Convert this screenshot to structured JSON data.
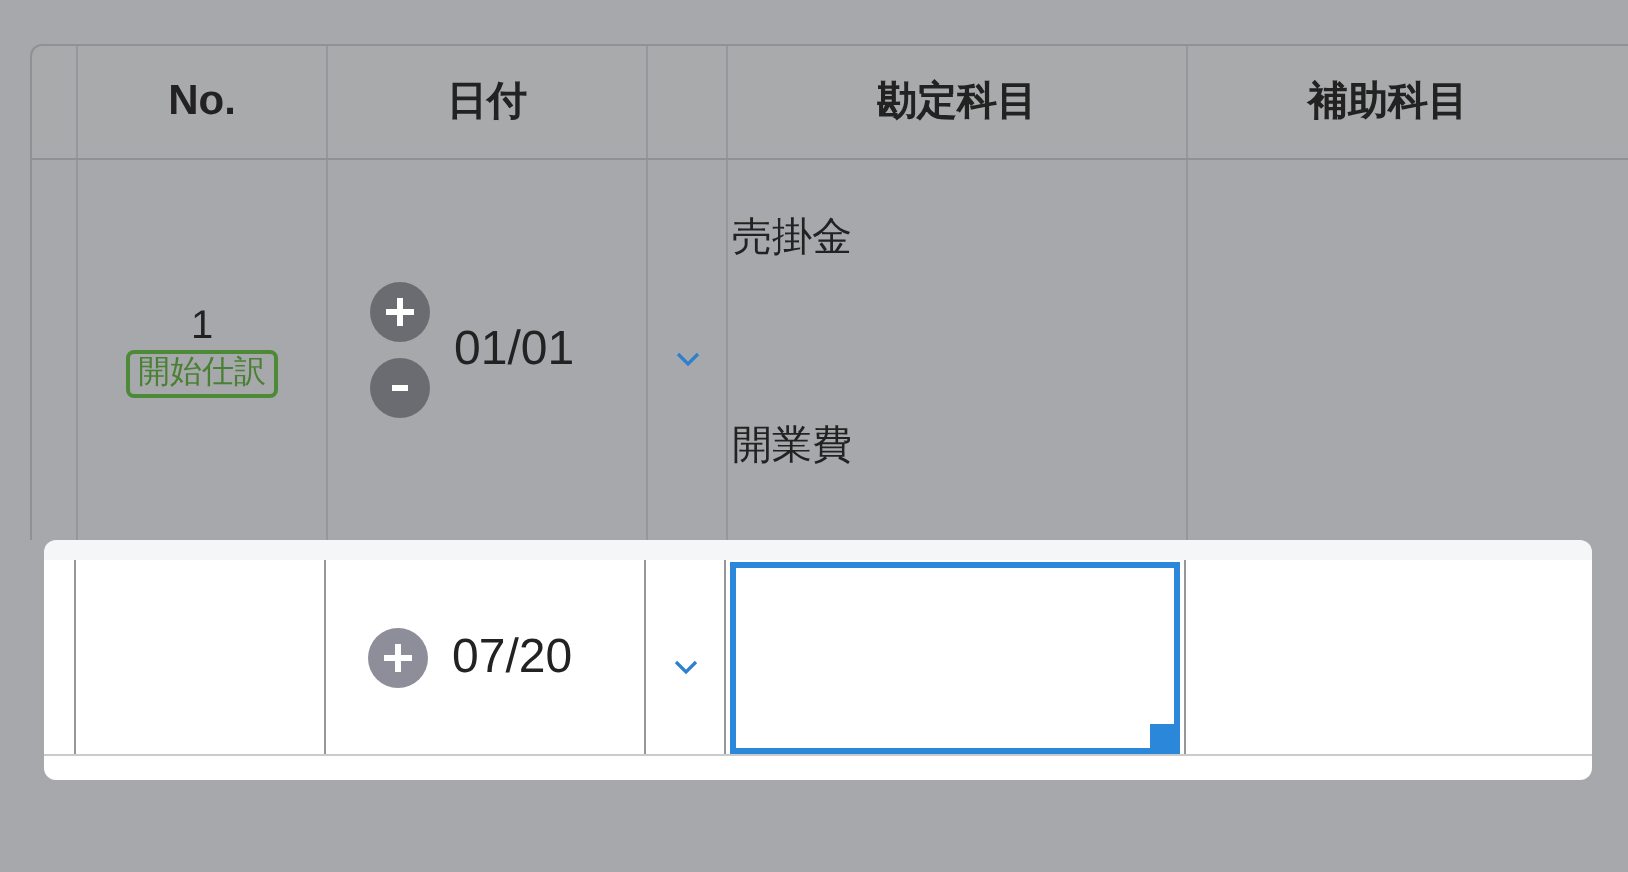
{
  "table": {
    "columns": {
      "no": "No.",
      "date": "日付",
      "account": "勘定科目",
      "sub_account": "補助科目"
    },
    "rows": [
      {
        "highlighted": false,
        "no": "1",
        "badge": "開始仕訳",
        "date_controls": [
          {
            "kind": "add"
          },
          {
            "kind": "remove"
          }
        ],
        "date": "01/01",
        "accounts": [
          "売掛金",
          "開業費"
        ]
      },
      {
        "highlighted": true,
        "date_controls": [
          {
            "kind": "add"
          }
        ],
        "date": "07/20",
        "account_field": {
          "focused": true
        }
      }
    ]
  }
}
